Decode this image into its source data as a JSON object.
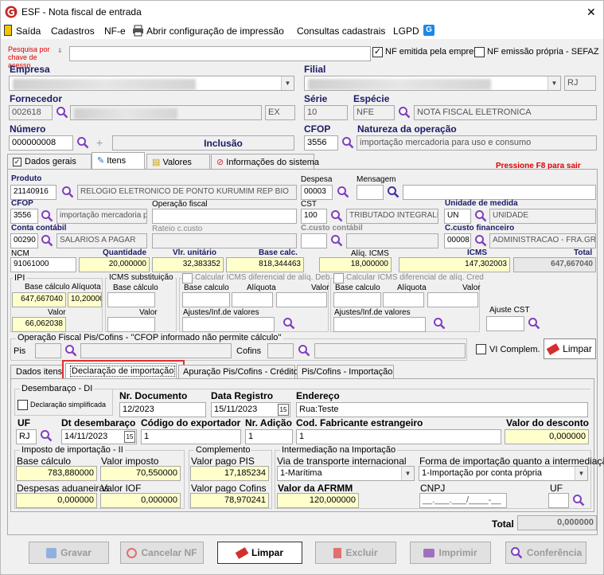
{
  "window": {
    "title": "ESF - Nota fiscal de entrada",
    "close": "✕"
  },
  "menu": {
    "saida": "Saída",
    "cadastros": "Cadastros",
    "nfe": "NF-e",
    "abrir": "Abrir configuração de impressão",
    "consultas": "Consultas cadastrais",
    "lgpd": "LGPD"
  },
  "header": {
    "pesquisa_label": "Pesquisa por chave de acesso",
    "pesquisa_value": "",
    "nf_emitida": "NF emitida pela empresa",
    "nf_emissao": "NF emissão própria - SEFAZ",
    "empresa_label": "Empresa",
    "filial_label": "Filial",
    "filial_uf": "RJ",
    "fornecedor_label": "Fornecedor",
    "fornecedor_code": "002618",
    "fornecedor_uf": "EX",
    "serie_label": "Série",
    "serie_value": "10",
    "especie_label": "Espécie",
    "especie_code": "NFE",
    "especie_desc": "NOTA FISCAL ELETRONICA",
    "numero_label": "Número",
    "numero_value": "000000008",
    "inclusao": "Inclusão",
    "cfop_label": "CFOP",
    "cfop_value": "3556",
    "natureza_label": "Natureza da operação",
    "natureza_value": "importação mercadoria para uso e consumo"
  },
  "tabs": {
    "dados_gerais": "Dados gerais",
    "itens": "Itens",
    "valores": "Valores",
    "informacoes": "Informações do sistema",
    "pressione": "Pressione F8 para sair"
  },
  "item": {
    "produto_label": "Produto",
    "produto_code": "21140916",
    "produto_desc": "RELOGIO ELETRONICO DE PONTO KURUMIM REP BIO",
    "despesa_label": "Despesa",
    "despesa_value": "00003",
    "mensagem_label": "Mensagem",
    "cfop_label": "CFOP",
    "cfop_value": "3556",
    "cfop_desc": "importação mercadoria pa",
    "operacao_label": "Operação fiscal",
    "cst_label": "CST",
    "cst_value": "100",
    "cst_desc": "TRIBUTADO INTEGRALM",
    "unidade_label": "Unidade de medida",
    "unidade_code": "UN",
    "unidade_desc": "UNIDADE",
    "conta_label": "Conta contábil",
    "conta_code": "00290",
    "conta_desc": "SALARIOS A PAGAR",
    "rateio_label": "Rateio c.custo",
    "ccusto_label": "C.custo contábil",
    "ccusto_fin_label": "C.custo financeiro",
    "ccusto_fin_code": "00008",
    "ccusto_fin_desc": "ADMINISTRACAO - FRA.GRU",
    "ncm_label": "NCM",
    "ncm_value": "91061000",
    "qtd_label": "Quantidade",
    "qtd_value": "20,000000",
    "vlr_label": "Vlr. unitário",
    "vlr_value": "32,383352",
    "base_label": "Base calc.",
    "base_value": "818,344463",
    "aliq_label": "Alíq. ICMS",
    "aliq_value": "18,000000",
    "icms_label": "ICMS",
    "icms_value": "147,302003",
    "total_label": "Total",
    "total_value": "647,667040"
  },
  "ipi": {
    "title": "IPI",
    "base_label": "Base cálculo",
    "base_value": "647,667040",
    "aliq_label": "Alíquota",
    "aliq_value": "10,200000",
    "valor_label": "Valor",
    "valor_value": "66,062038"
  },
  "icms_st": {
    "title": "ICMS substituição",
    "base_label": "Base cálculo",
    "valor_label": "Valor"
  },
  "difal_deb": {
    "title": "Calcular ICMS diferencial de alíq. Deb",
    "base_label": "Base calculo",
    "aliq_label": "Alíquota",
    "valor_label": "Valor",
    "ajustes_label": "Ajustes/Inf.de valores"
  },
  "difal_cred": {
    "title": "Calcular ICMS diferencial de alíq. Cred",
    "base_label": "Base calculo",
    "aliq_label": "Alíquota",
    "valor_label": "Valor",
    "ajustes_label": "Ajustes/Inf.de valores"
  },
  "ajuste_cst": "Ajuste CST",
  "piscofins": {
    "title": "Operação Fiscal Pis/Cofins - ''CFOP informado não permite cálculo''",
    "pis_label": "Pis",
    "cofins_label": "Cofins",
    "vi_complem": "VI Complem.",
    "limpar": "Limpar"
  },
  "subtabs": {
    "dados_itens": "Dados itens",
    "declaracao": "Declaração de importação",
    "apuracao": "Apuração Pis/Cofins - Crédito",
    "piscofins_imp": "Pis/Cofins - Importação"
  },
  "di": {
    "desembaraco": "Desembaraço - DI",
    "simplificada": "Declaração simplificada",
    "nrdoc_label": "Nr. Documento",
    "nrdoc_value": "12/2023",
    "dtreg_label": "Data Registro",
    "dtreg_value": "15/11/2023",
    "endereco_label": "Endereço",
    "endereco_value": "Rua:Teste",
    "uf_label": "UF",
    "uf_value": "RJ",
    "dtdes_label": "Dt desembaraço",
    "dtdes_value": "14/11/2023",
    "codexp_label": "Código do exportador",
    "codexp_value": "1",
    "nradic_label": "Nr. Adição",
    "nradic_value": "1",
    "codfab_label": "Cod. Fabricante estrangeiro",
    "codfab_value": "1",
    "vldesc_label": "Valor do desconto",
    "vldesc_value": "0,000000"
  },
  "imposto_imp": {
    "title": "Imposto de importação - II",
    "base_label": "Base cálculo",
    "base_value": "783,880000",
    "valor_label": "Valor imposto",
    "valor_value": "70,550000",
    "desp_label": "Despesas aduaneiras",
    "desp_value": "0,000000",
    "iof_label": "Valor IOF",
    "iof_value": "0,000000"
  },
  "complemento": {
    "title": "Complemento",
    "pis_label": "Valor pago PIS",
    "pis_value": "17,185234",
    "cofins_label": "Valor pago Cofins",
    "cofins_value": "78,970241"
  },
  "intermed": {
    "title": "Intermediação na Importação",
    "via_label": "Via de transporte internacional",
    "via_value": "1-Marítima",
    "forma_label": "Forma de importação quanto a intermediação",
    "forma_value": "1-Importação por conta própria",
    "afrmm_label": "Valor da AFRMM",
    "afrmm_value": "120,000000",
    "cnpj_label": "CNPJ",
    "cnpj_value": "__.___.___/____-__",
    "uf_label": "UF"
  },
  "footer_total": {
    "label": "Total",
    "value": "0,000000"
  },
  "buttons": {
    "gravar": "Gravar",
    "cancelar": "Cancelar NF",
    "limpar": "Limpar",
    "excluir": "Excluir",
    "imprimir": "Imprimir",
    "conferencia": "Conferência"
  },
  "colors": {
    "label_blue": "#1a1a66",
    "highlight_red": "#e03030",
    "yellow": "#ffffcc",
    "magnifier": "#8040c0"
  }
}
